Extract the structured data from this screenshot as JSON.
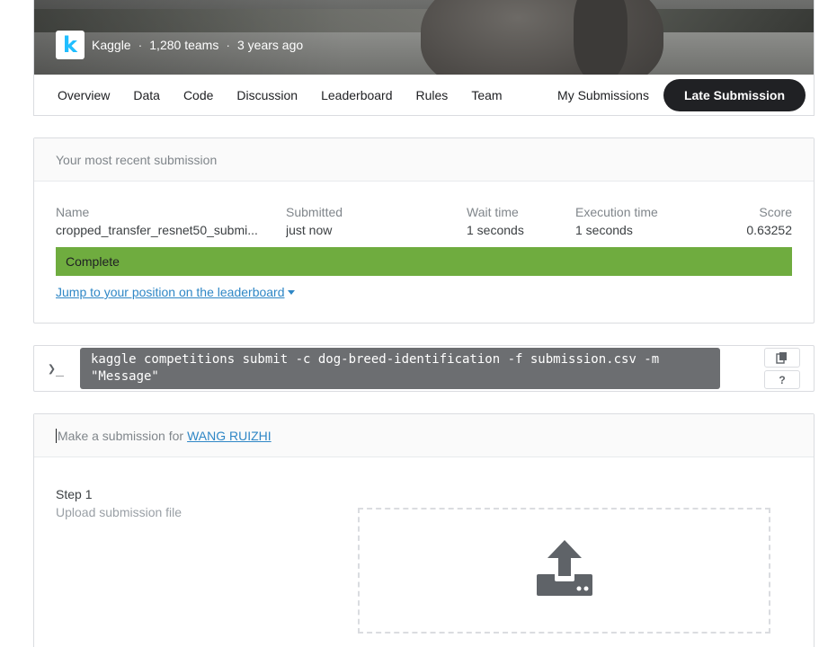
{
  "competition": {
    "logo_letter": "k",
    "host": "Kaggle",
    "teams": "1,280 teams",
    "age": "3 years ago",
    "separator": "·"
  },
  "tabs": [
    "Overview",
    "Data",
    "Code",
    "Discussion",
    "Leaderboard",
    "Rules",
    "Team"
  ],
  "my_submissions_label": "My Submissions",
  "late_submission_label": "Late Submission",
  "recent": {
    "heading": "Your most recent submission",
    "columns": {
      "name": "Name",
      "submitted": "Submitted",
      "wait": "Wait time",
      "exec": "Execution time",
      "score": "Score"
    },
    "values": {
      "name": "cropped_transfer_resnet50_submi...",
      "submitted": "just now",
      "wait": "1 seconds",
      "exec": "1 seconds",
      "score": "0.63252"
    },
    "status": "Complete",
    "status_color": "#6fac3f",
    "jump_link": "Jump to your position on the leaderboard"
  },
  "command": {
    "prompt_glyph": "❯_",
    "line1": "kaggle competitions submit -c dog-breed-identification -f submission.csv -m",
    "line2": "\"Message\"",
    "help_label": "?"
  },
  "make": {
    "heading_prefix": "Make a submission for",
    "user_link": "WANG RUIZHI",
    "step_title": "Step 1",
    "step_sub": "Upload submission file"
  },
  "icons": {
    "logo": "kaggle-logo",
    "copy": "copy-icon",
    "upload": "upload-icon",
    "caret": "caret-down-icon"
  }
}
